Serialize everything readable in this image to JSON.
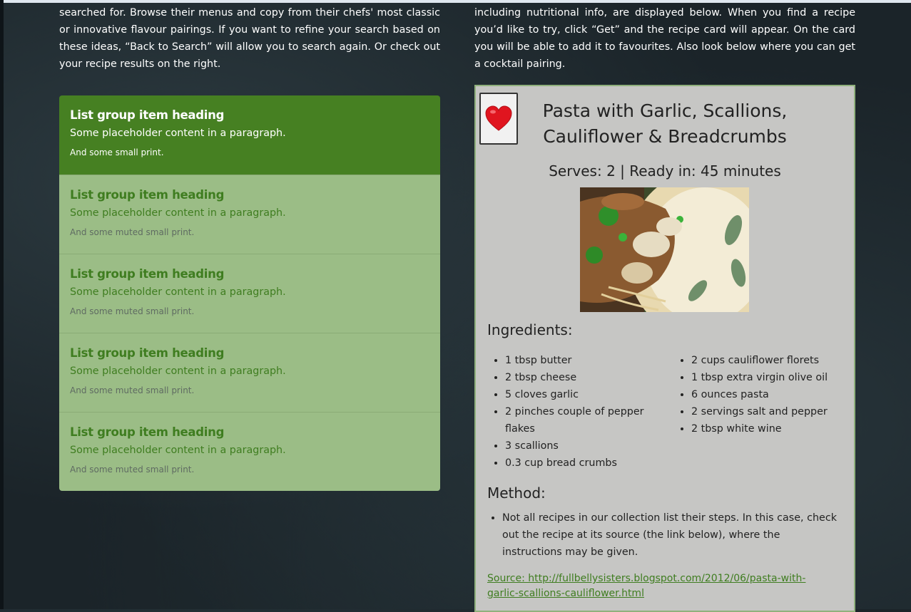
{
  "intro": {
    "left": "searched for. Browse their menus and copy from their chefs' most classic or innovative flavour pairings. If you want to refine your search based on these ideas, “Back to Search” will allow you to search again. Or check out your recipe results on the right.",
    "right": "including nutritional info, are displayed below. When you find a recipe you’d like to try, click “Get” and the recipe card will appear. On the card you will be able to add it to favourites. Also look below where you can get a cocktail pairing."
  },
  "list_group": {
    "items": [
      {
        "heading": "List group item heading",
        "text": "Some placeholder content in a paragraph.",
        "small": "And some small print."
      },
      {
        "heading": "List group item heading",
        "text": "Some placeholder content in a paragraph.",
        "small": "And some muted small print."
      },
      {
        "heading": "List group item heading",
        "text": "Some placeholder content in a paragraph.",
        "small": "And some muted small print."
      },
      {
        "heading": "List group item heading",
        "text": "Some placeholder content in a paragraph.",
        "small": "And some muted small print."
      },
      {
        "heading": "List group item heading",
        "text": "Some placeholder content in a paragraph.",
        "small": "And some muted small print."
      }
    ]
  },
  "recipe": {
    "favourite_icon": "heart-icon",
    "title": "Pasta with Garlic, Scallions, Cauliflower & Breadcrumbs",
    "serves": "Serves: 2 | Ready in: 45 minutes",
    "ingredients_heading": "Ingredients:",
    "ingredients_col1": [
      "1 tbsp butter",
      "2 tbsp cheese",
      "5 cloves garlic",
      "2 pinches couple of pepper flakes",
      "3 scallions",
      "0.3 cup bread crumbs"
    ],
    "ingredients_col2": [
      "2 cups cauliflower florets",
      "1 tbsp extra virgin olive oil",
      "6 ounces pasta",
      "2 servings salt and pepper",
      "2 tbsp white wine"
    ],
    "method_heading": "Method:",
    "method_steps": [
      "Not all recipes in our collection list their steps. In this case, check out the recipe at its source (the link below), where the instructions may be given."
    ],
    "source": "Source: http://fullbellysisters.blogspot.com/2012/06/pasta-with-garlic-scallions-cauliflower.html"
  },
  "colors": {
    "active_item": "#468022",
    "item_bg": "#9bbd86",
    "accent_text": "#3f7d20",
    "card_bg": "#c6c6c4"
  }
}
